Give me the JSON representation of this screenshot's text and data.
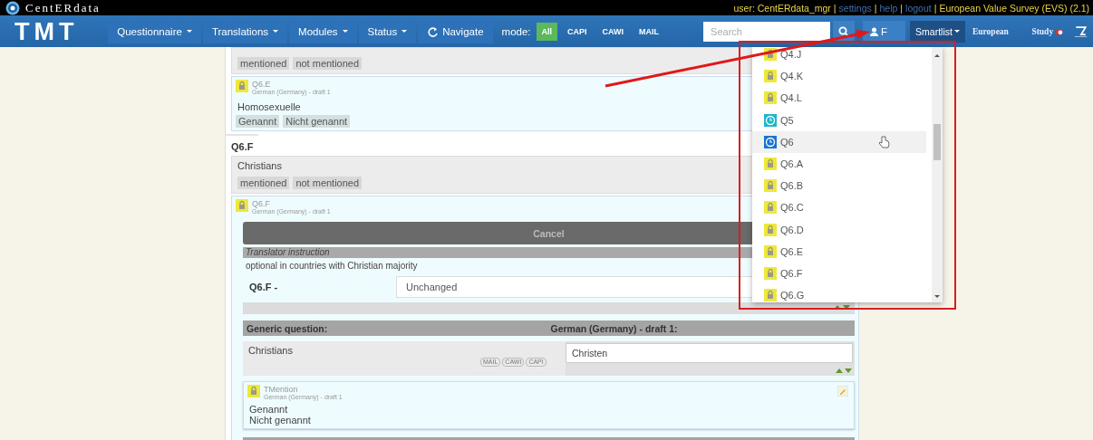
{
  "top_bar": {
    "brand": "CentERdata",
    "items": [
      {
        "kind": "text",
        "text": "user: CentERdata_mgr"
      },
      {
        "kind": "sep",
        "text": "|"
      },
      {
        "kind": "link",
        "text": "settings"
      },
      {
        "kind": "sep",
        "text": "|"
      },
      {
        "kind": "link",
        "text": "help"
      },
      {
        "kind": "sep",
        "text": "|"
      },
      {
        "kind": "link",
        "text": "logout"
      },
      {
        "kind": "sep",
        "text": "|"
      },
      {
        "kind": "text",
        "text": "European Value Survey (EVS) (2.1)"
      }
    ]
  },
  "nav": {
    "logo": "TMT",
    "menus": [
      {
        "label": "Questionnaire",
        "kind": "dropdown"
      },
      {
        "label": "Translations",
        "kind": "dropdown"
      },
      {
        "label": "Modules",
        "kind": "dropdown"
      },
      {
        "label": "Status",
        "kind": "dropdown"
      },
      {
        "label": "Navigate",
        "kind": "refresh"
      }
    ],
    "mode_label": "mode:",
    "modes": [
      {
        "label": "All",
        "selected": true
      },
      {
        "label": "CAPI",
        "selected": false
      },
      {
        "label": "CAWI",
        "selected": false
      },
      {
        "label": "MAIL",
        "selected": false
      }
    ],
    "search": {
      "placeholder": "Search"
    },
    "user_button": {
      "label": "F"
    },
    "smartlist": {
      "label": "Smartlist"
    },
    "brand": [
      "European",
      "Study"
    ]
  },
  "content": {
    "prev_source": {
      "tags": [
        "mentioned",
        "not mentioned"
      ]
    },
    "prev_translation": {
      "code": "Q6.E",
      "meta": "German (Germany) - draft 1",
      "text": "Homosexuelle",
      "tags": [
        "Genannt",
        "Nicht genannt"
      ]
    },
    "heading": "Q6.F",
    "source": {
      "text": "Christians",
      "tags": [
        "mentioned",
        "not mentioned"
      ]
    },
    "editor": {
      "code": "Q6.F",
      "meta": "German (Germany) - draft 1",
      "cancel": "Cancel",
      "instruction_label": "Translator instruction",
      "instruction": "optional in countries with Christian majority",
      "status_label": "Q6.F -",
      "status_value": "Unchanged",
      "columns": [
        "Generic question:",
        "German (Germany) - draft 1:"
      ],
      "generic_text": "Christians",
      "mode_pills": [
        "MAIL",
        "CAWI",
        "CAPI"
      ],
      "translation_value": "Christen",
      "answer": {
        "code": "TMention",
        "meta": "German (Germany) - draft 1",
        "lines": [
          "Genannt",
          "Nicht genannt"
        ]
      }
    }
  },
  "smartlist_dropdown": {
    "items": [
      {
        "label": "Q4.J",
        "kind": "lock",
        "color": "#eee83a",
        "highlighted": false
      },
      {
        "label": "Q4.K",
        "kind": "lock",
        "color": "#eee83a",
        "highlighted": false
      },
      {
        "label": "Q4.L",
        "kind": "lock",
        "color": "#eee83a",
        "highlighted": false
      },
      {
        "label": "Q5",
        "kind": "clock",
        "color": "#1fb6c9",
        "highlighted": false
      },
      {
        "label": "Q6",
        "kind": "clock",
        "color": "#1b74cf",
        "highlighted": true
      },
      {
        "label": "Q6.A",
        "kind": "lock",
        "color": "#eee83a",
        "highlighted": false
      },
      {
        "label": "Q6.B",
        "kind": "lock",
        "color": "#eee83a",
        "highlighted": false
      },
      {
        "label": "Q6.C",
        "kind": "lock",
        "color": "#eee83a",
        "highlighted": false
      },
      {
        "label": "Q6.D",
        "kind": "lock",
        "color": "#eee83a",
        "highlighted": false
      },
      {
        "label": "Q6.E",
        "kind": "lock",
        "color": "#eee83a",
        "highlighted": false
      },
      {
        "label": "Q6.F",
        "kind": "lock",
        "color": "#eee83a",
        "highlighted": false
      },
      {
        "label": "Q6.G",
        "kind": "lock",
        "color": "#eee83a",
        "highlighted": false
      }
    ]
  }
}
